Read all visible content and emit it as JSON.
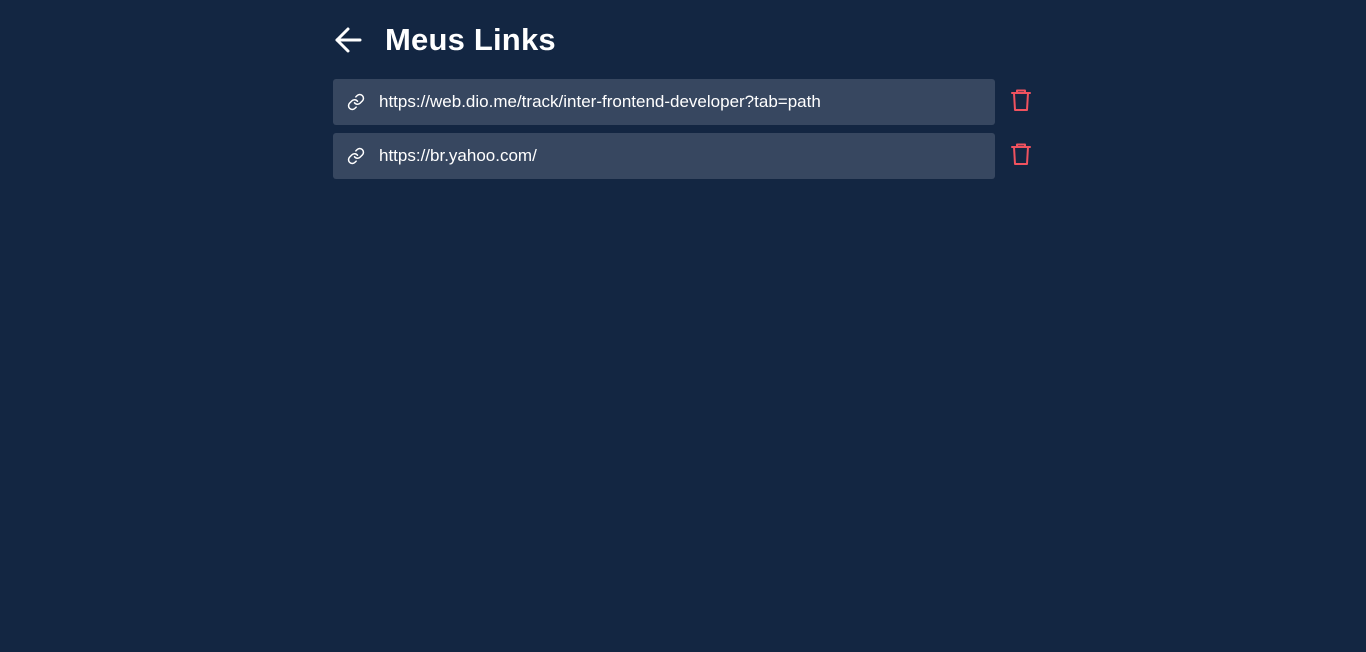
{
  "header": {
    "title": "Meus Links",
    "back_icon": "arrow-left-icon"
  },
  "colors": {
    "background": "#132642",
    "link_item_background": "#374760",
    "text": "#ffffff",
    "delete_icon": "#f0525f"
  },
  "links": [
    {
      "url": "https://web.dio.me/track/inter-frontend-developer?tab=path",
      "icon": "link-icon",
      "action_icon": "trash-icon"
    },
    {
      "url": "https://br.yahoo.com/",
      "icon": "link-icon",
      "action_icon": "trash-icon"
    }
  ]
}
